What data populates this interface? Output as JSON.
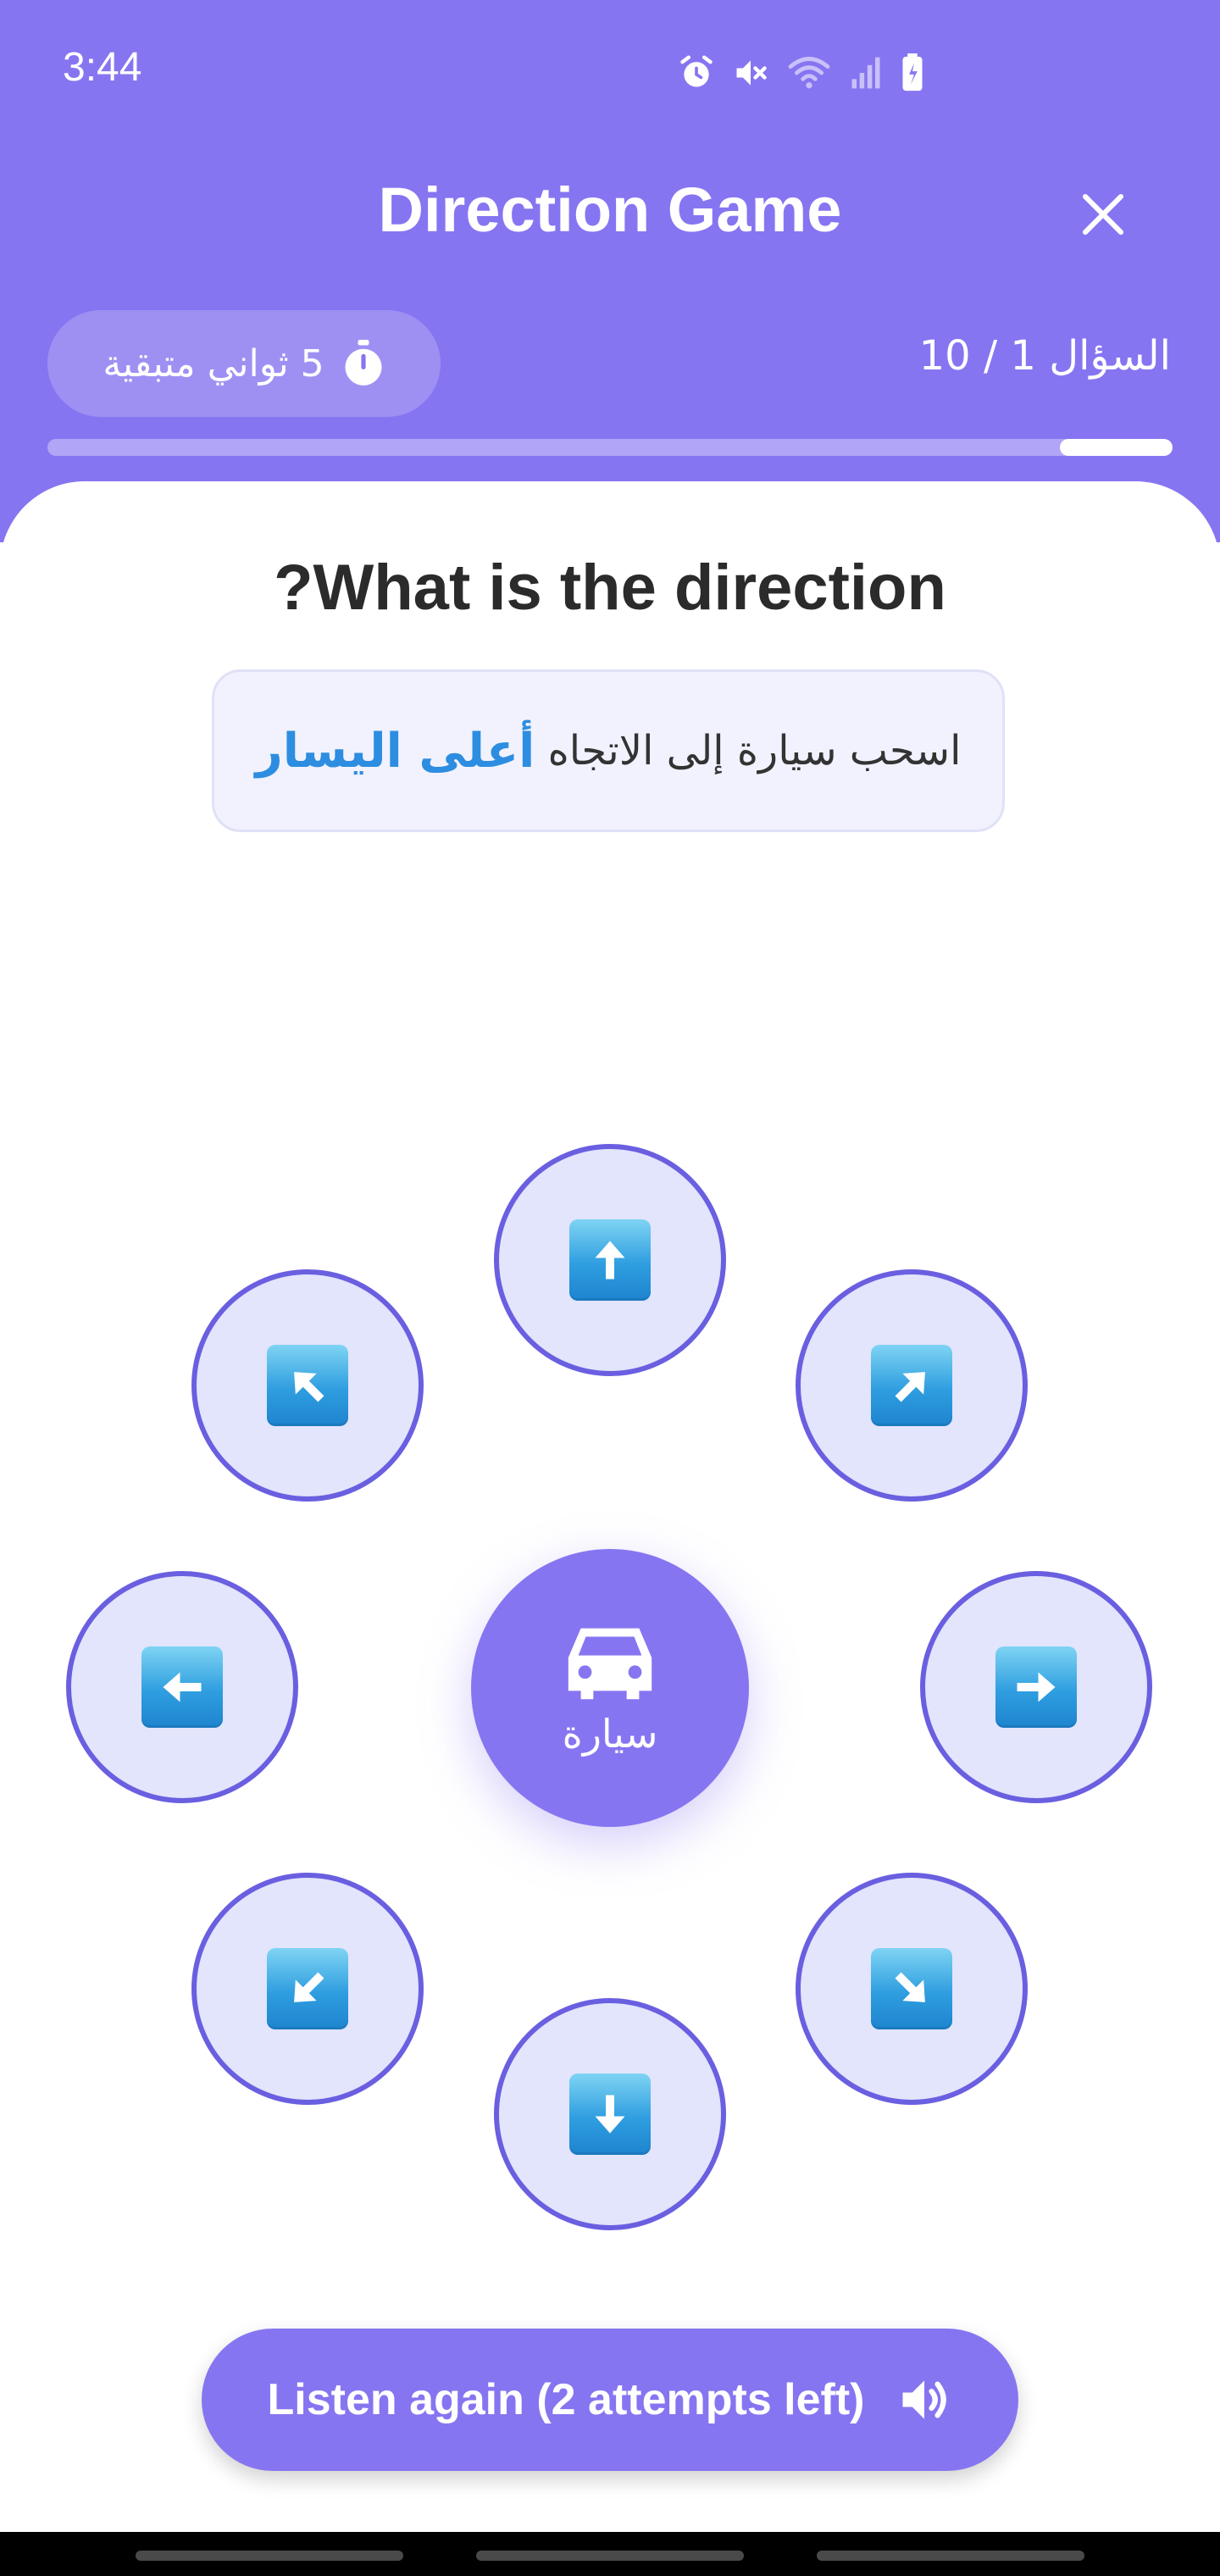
{
  "status_bar": {
    "time": "3:44",
    "icons": [
      "alarm-icon",
      "mute-icon",
      "wifi-icon",
      "signal-icon",
      "battery-icon"
    ]
  },
  "header": {
    "title": "Direction Game",
    "close_icon": "close-icon",
    "timer_text": "5 ثواني متبقية",
    "timer_icon": "stopwatch-icon",
    "question_counter": "السؤال 1 / 10",
    "progress": 0.1
  },
  "main": {
    "question": "What is the direction?",
    "instruction_prefix": "اسحب سيارة إلى الاتجاه",
    "instruction_highlight": "أعلى اليسار",
    "center_label": "سيارة",
    "center_icon": "car-icon",
    "directions": [
      "up",
      "up-right",
      "right",
      "down-right",
      "down",
      "down-left",
      "left",
      "up-left"
    ]
  },
  "listen_button": {
    "label": "Listen again (2 attempts left)",
    "icon": "speaker-icon"
  },
  "colors": {
    "primary": "#8675F1",
    "button_border": "#6a5fe0",
    "button_fill": "#e2e5fc",
    "highlight": "#2d8de0",
    "arrow_tile": "#2f9ee0"
  }
}
